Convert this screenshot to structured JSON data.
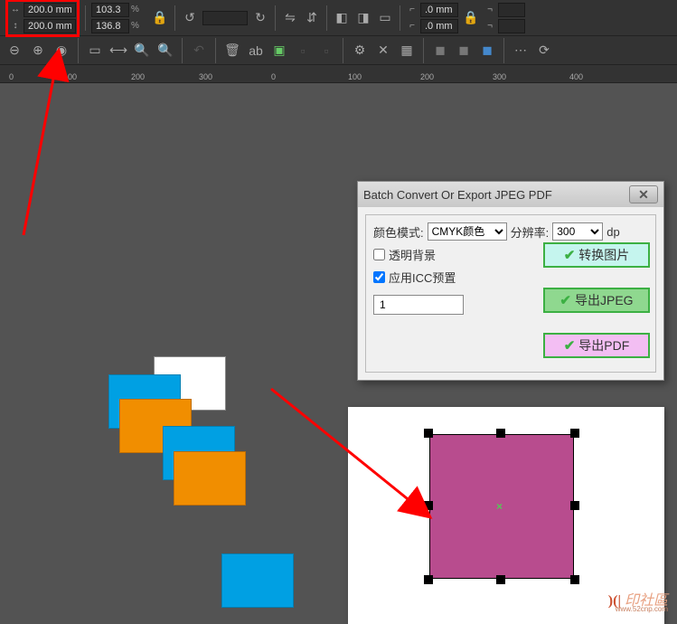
{
  "toolbar": {
    "width_value": "200.0 mm",
    "height_value": "200.0 mm",
    "scale_x": "103.3",
    "scale_y": "136.8",
    "percent": "%",
    "corner_top": ".0 mm",
    "corner_bottom": ".0 mm"
  },
  "ruler": {
    "ticks": [
      "0",
      "100",
      "200",
      "300",
      "0",
      "100",
      "200",
      "300",
      "400"
    ]
  },
  "dialog": {
    "title": "Batch Convert Or Export JPEG PDF",
    "color_mode_label": "颜色模式:",
    "color_mode_value": "CMYK颜色",
    "dpi_label": "分辨率:",
    "dpi_value": "300",
    "dpi_unit": "dp",
    "transparent_bg": "透明背景",
    "icc_profile": "应用ICC预置",
    "num_value": "1",
    "btn_convert": "转换图片",
    "btn_jpeg": "导出JPEG",
    "btn_pdf": "导出PDF"
  },
  "watermark": {
    "text": "印社區",
    "url": "www.52cnp.com"
  }
}
